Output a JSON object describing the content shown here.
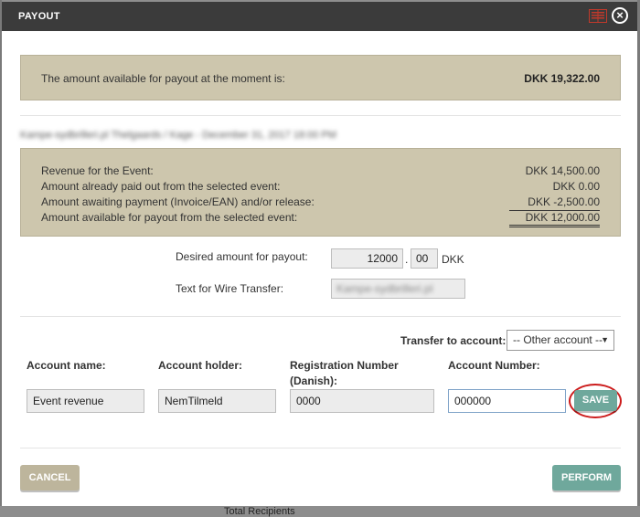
{
  "modal": {
    "title": "PAYOUT",
    "close_icon": "close-icon",
    "doc_icon": "document-icon"
  },
  "available": {
    "label": "The amount available for payout at the moment is:",
    "value": "DKK 19,322.00"
  },
  "event": {
    "heading": "Kampe-sydbrilleri.pl Thelgaards / Kage - December 31, 2017 18:00 PM",
    "rows": [
      {
        "label": "Revenue for the Event:",
        "value": "DKK 14,500.00"
      },
      {
        "label": "Amount already paid out from the selected event:",
        "value": "DKK 0.00"
      },
      {
        "label": "Amount awaiting payment (Invoice/EAN) and/or release:",
        "value": "DKK -2,500.00"
      },
      {
        "label": "Amount available for payout from the selected event:",
        "value": "DKK 12,000.00"
      }
    ]
  },
  "form": {
    "desired_label": "Desired amount for payout:",
    "amount_whole": "12000",
    "decimal_sep": ".",
    "amount_cents": "00",
    "currency": "DKK",
    "wire_label": "Text for Wire Transfer:",
    "wire_value": "Kampe-sydbrilleri.pl"
  },
  "transfer": {
    "label": "Transfer to account:",
    "selected": "-- Other account --"
  },
  "account": {
    "name_label": "Account name:",
    "holder_label": "Account holder:",
    "reg_label_line1": "Registration Number",
    "reg_label_line2": "(Danish):",
    "number_label": "Account Number:",
    "name_value": "Event revenue",
    "holder_value": "NemTilmeld",
    "reg_value": "0000",
    "number_value": "000000",
    "save_label": "SAVE"
  },
  "footer": {
    "cancel_label": "CANCEL",
    "perform_label": "PERFORM"
  },
  "background": {
    "text": "Total Recipients"
  },
  "colors": {
    "panel": "#cdc6ad",
    "accent_teal": "#6fa89c",
    "cancel": "#bdb59c",
    "highlight_ring": "#cc1c1c"
  }
}
